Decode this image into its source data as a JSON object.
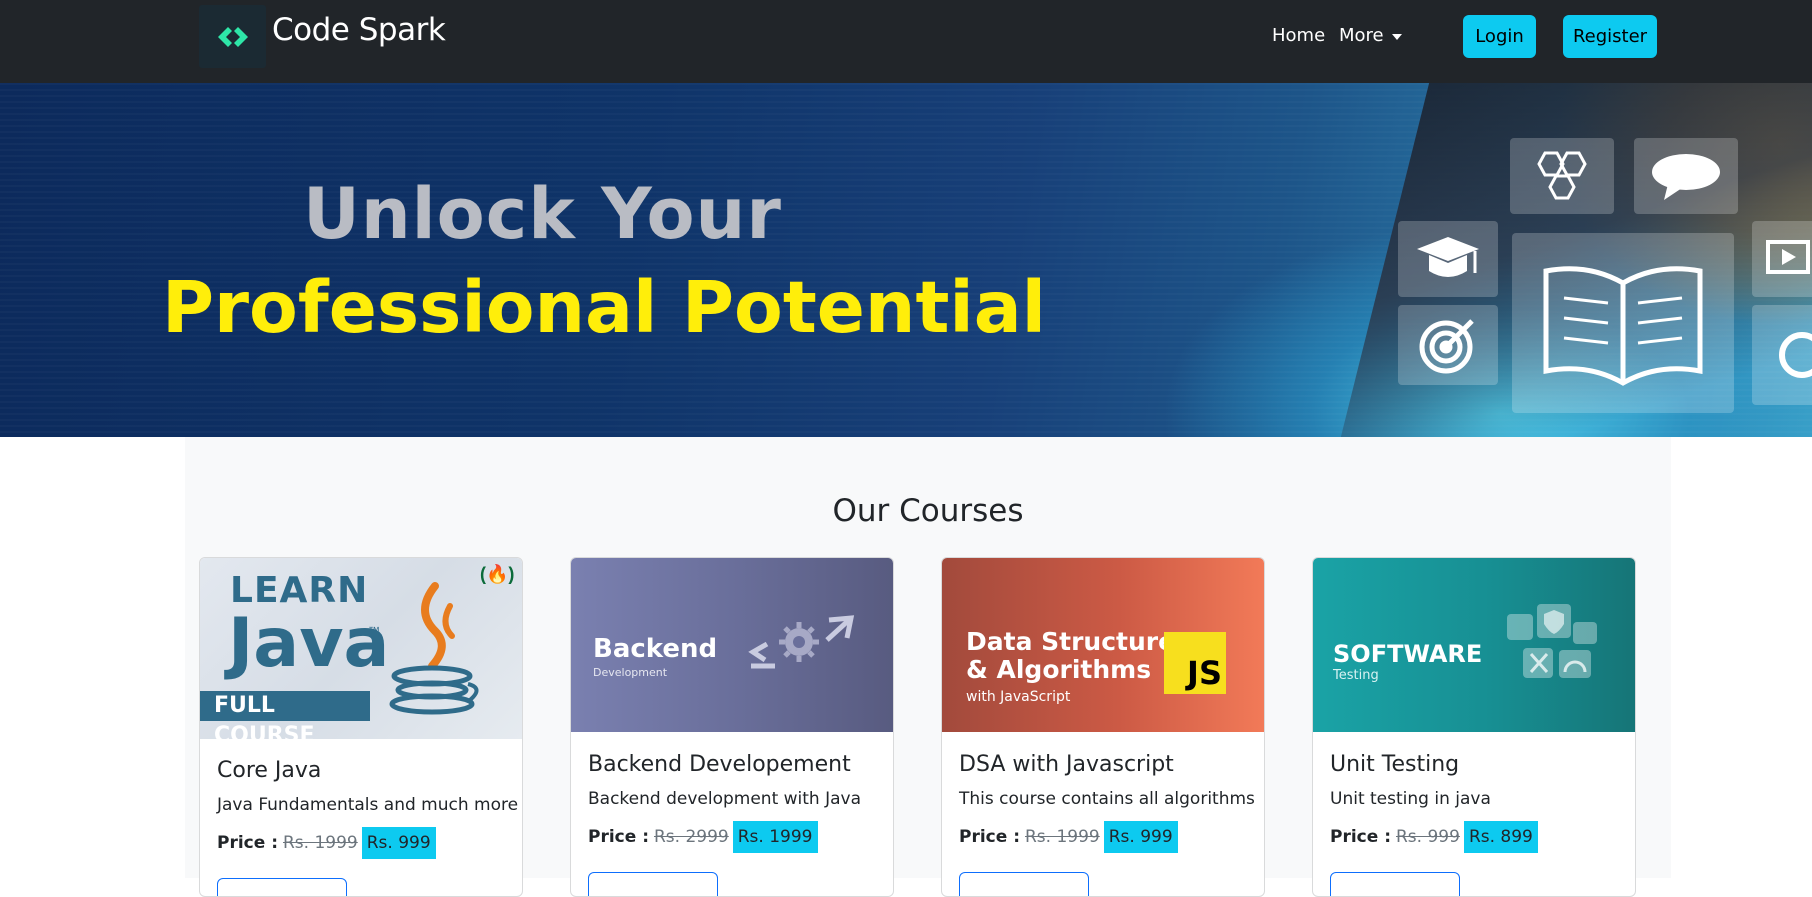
{
  "navbar": {
    "brand": "Code Spark",
    "links": {
      "home": "Home",
      "more": "More"
    },
    "buttons": {
      "login": "Login",
      "register": "Register"
    }
  },
  "hero": {
    "line1": "Unlock Your",
    "line2": "Professional Potential"
  },
  "courses": {
    "title": "Our Courses",
    "price_label": "Price :",
    "items": [
      {
        "title": "Core Java",
        "description": "Java Fundamentals and much more",
        "old_price": "Rs. 1999",
        "new_price": "Rs. 999",
        "image": {
          "line1": "LEARN",
          "line2": "Java",
          "tm": "™",
          "line3": "FULL COURSE",
          "badge": "(🔥)"
        }
      },
      {
        "title": "Backend Developement",
        "description": "Backend development with Java",
        "old_price": "Rs. 2999",
        "new_price": "Rs. 1999",
        "image": {
          "line1": "Backend",
          "line2": "Development"
        }
      },
      {
        "title": "DSA with Javascript",
        "description": "This course contains all algorithms",
        "old_price": "Rs. 1999",
        "new_price": "Rs. 999",
        "image": {
          "line1": "Data Structures",
          "line2": "& Algorithms",
          "line3": "with JavaScript",
          "badge": "JS"
        }
      },
      {
        "title": "Unit Testing",
        "description": "Unit testing in java",
        "old_price": "Rs. 999",
        "new_price": "Rs. 899",
        "image": {
          "line1": "SOFTWARE",
          "line2": "Testing"
        }
      }
    ]
  },
  "colors": {
    "navbar_bg": "#212529",
    "accent_info": "#0dcaf0",
    "hero_headline": "#ffee0a",
    "primary_outline": "#0d6efd"
  }
}
